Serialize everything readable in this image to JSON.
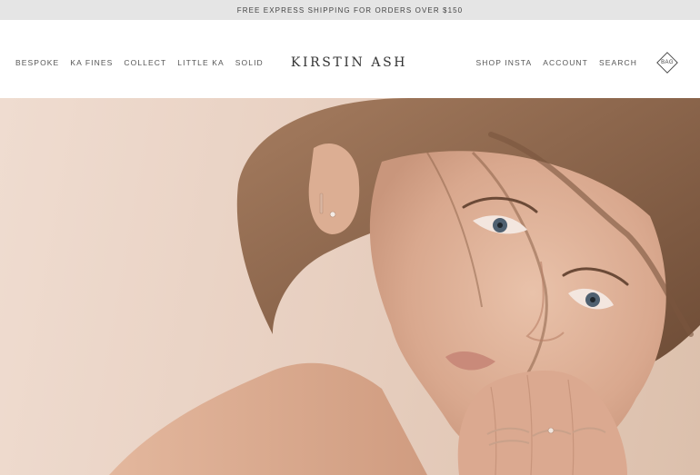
{
  "announcement": {
    "text": "FREE EXPRESS SHIPPING FOR ORDERS OVER $150"
  },
  "nav_left": [
    {
      "label": "BESPOKE"
    },
    {
      "label": "KA FINES"
    },
    {
      "label": "COLLECT"
    },
    {
      "label": "LITTLE KA"
    },
    {
      "label": "SOLID"
    }
  ],
  "logo": {
    "text": "KIRSTIN ASH"
  },
  "nav_right": [
    {
      "label": "SHOP INSTA"
    },
    {
      "label": "ACCOUNT"
    },
    {
      "label": "SEARCH"
    }
  ],
  "bag": {
    "label": "BAG"
  },
  "colors": {
    "announcement_bg": "#e5e5e5",
    "background": "#ffffff",
    "text": "#555555",
    "hero_bg": "#e8d0c1"
  }
}
